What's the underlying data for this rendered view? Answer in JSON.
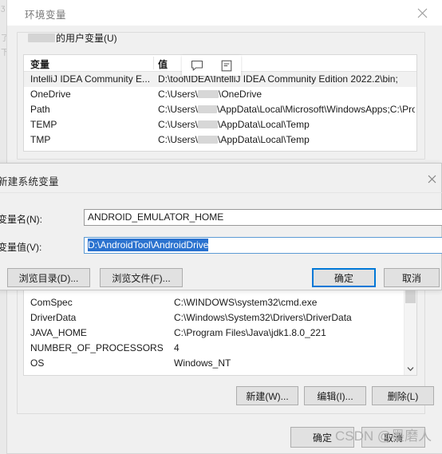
{
  "window": {
    "title": "环境变量",
    "close_icon": "close-icon"
  },
  "user_section": {
    "legend_suffix": "的用户变量(U)",
    "columns": [
      "变量",
      "值"
    ],
    "rows": [
      {
        "name": "IntelliJ IDEA Community E...",
        "value": "D:\\tool\\IDEA\\IntelliJ IDEA Community Edition 2022.2\\bin;",
        "selected": true
      },
      {
        "name": "OneDrive",
        "value_prefix": "C:\\Users\\",
        "value_suffix": "\\OneDrive"
      },
      {
        "name": "Path",
        "value_prefix": "C:\\Users\\",
        "value_suffix": "\\AppData\\Local\\Microsoft\\WindowsApps;C:\\Pro..."
      },
      {
        "name": "TEMP",
        "value_prefix": "C:\\Users\\",
        "value_suffix": "\\AppData\\Local\\Temp"
      },
      {
        "name": "TMP",
        "value_prefix": "C:\\Users\\",
        "value_suffix": "\\AppData\\Local\\Temp"
      }
    ]
  },
  "float_tools": {
    "comment_icon": "comment-icon",
    "note_icon": "note-icon"
  },
  "system_section": {
    "rows": [
      {
        "name": "ComSpec",
        "value": "C:\\WINDOWS\\system32\\cmd.exe"
      },
      {
        "name": "DriverData",
        "value": "C:\\Windows\\System32\\Drivers\\DriverData"
      },
      {
        "name": "JAVA_HOME",
        "value": "C:\\Program Files\\Java\\jdk1.8.0_221"
      },
      {
        "name": "NUMBER_OF_PROCESSORS",
        "value": "4"
      },
      {
        "name": "OS",
        "value": "Windows_NT"
      }
    ],
    "buttons": {
      "new": "新建(W)...",
      "edit": "编辑(I)...",
      "delete": "删除(L)"
    }
  },
  "footer": {
    "ok": "确定",
    "cancel": "取消"
  },
  "modal": {
    "title": "新建系统变量",
    "close_icon": "close-icon",
    "name_label": "变量名(N):",
    "name_value": "ANDROID_EMULATOR_HOME",
    "value_label": "变量值(V):",
    "value_value": "D:\\AndroidTool\\AndroidDrive",
    "browse_dir": "浏览目录(D)...",
    "browse_file": "浏览文件(F)...",
    "ok": "确定",
    "cancel": "取消"
  },
  "watermark": {
    "text": "CSDN @墨磨人"
  },
  "colors": {
    "accent": "#0078d7",
    "selection": "#2a72cf",
    "window_bg": "#f0f0f0"
  }
}
